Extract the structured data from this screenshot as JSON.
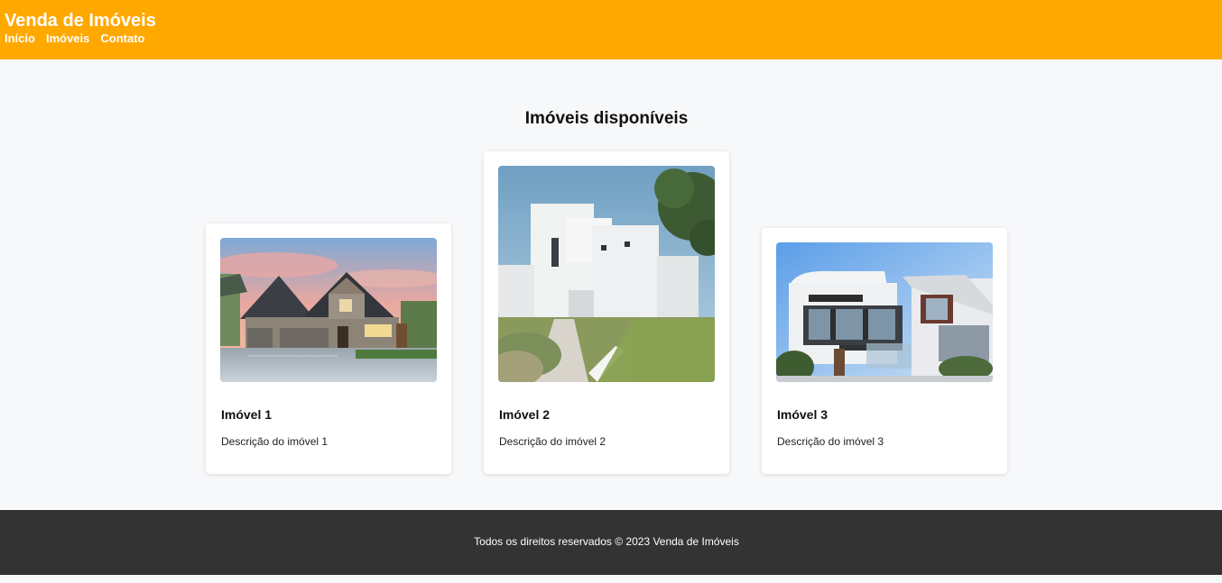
{
  "header": {
    "title": "Venda de Imóveis",
    "nav": [
      "Início",
      "Imóveis",
      "Contato"
    ]
  },
  "main": {
    "section_title": "Imóveis disponíveis",
    "listings": [
      {
        "title": "Imóvel 1",
        "description": "Descrição do imóvel 1"
      },
      {
        "title": "Imóvel 2",
        "description": "Descrição do imóvel 2"
      },
      {
        "title": "Imóvel 3",
        "description": "Descrição do imóvel 3"
      }
    ]
  },
  "footer": {
    "text": "Todos os direitos reservados © 2023 Venda de Imóveis"
  },
  "colors": {
    "header_bg": "#ffa800",
    "footer_bg": "#333333",
    "page_bg": "#f7f8fa"
  }
}
